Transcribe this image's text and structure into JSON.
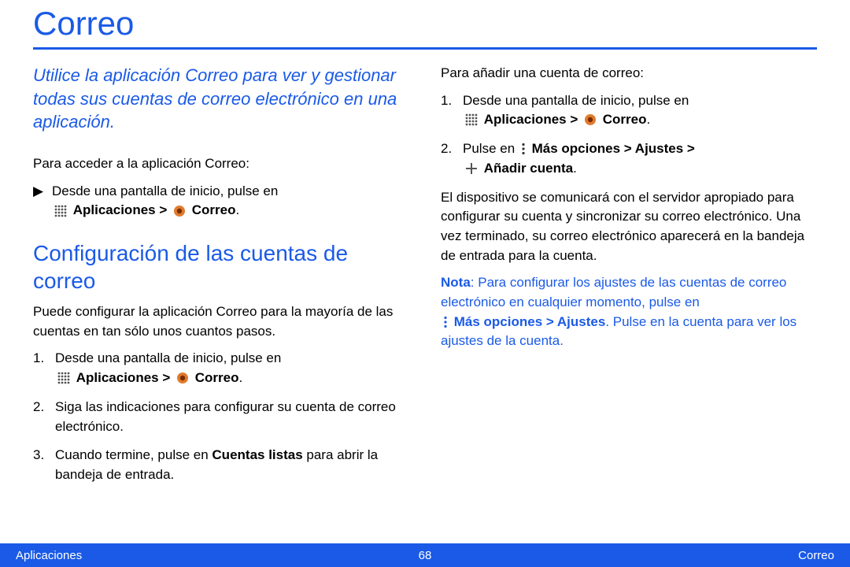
{
  "title": "Correo",
  "intro": "Utilice la aplicación Correo para ver y gestionar todas sus cuentas de correo electrónico en una aplicación.",
  "left": {
    "access_intro": "Para acceder a la aplicación Correo:",
    "access_step_pre": "Desde una pantalla de inicio, pulse en",
    "apps_label": "Aplicaciones >",
    "correo_label": "Correo",
    "period": ".",
    "section_heading": "Configuración de las cuentas de correo",
    "section_intro": "Puede configurar la aplicación Correo para la mayoría de las cuentas en tan sólo unos cuantos pasos.",
    "step1_pre": "Desde una pantalla de inicio, pulse en",
    "step2": "Siga las indicaciones para configurar su cuenta de correo electrónico.",
    "step3_pre": "Cuando termine, pulse en ",
    "step3_bold": "Cuentas listas",
    "step3_post": " para abrir la bandeja de entrada."
  },
  "right": {
    "add_intro": "Para añadir una cuenta de correo:",
    "step1_pre": "Desde una pantalla de inicio, pulse en",
    "apps_label": "Aplicaciones >",
    "correo_label": "Correo",
    "period": ".",
    "step2_pre": "Pulse en ",
    "more_options": "Más opciones > Ajustes >",
    "add_account": "Añadir cuenta",
    "result_para": "El dispositivo se comunicará con el servidor apropiado para configurar su cuenta y sincronizar su correo electrónico. Una vez terminado, su correo electrónico aparecerá en la bandeja de entrada para la cuenta.",
    "note_label": "Nota",
    "note_a": ": Para configurar los ajustes de las cuentas de correo electrónico en cualquier momento, pulse en",
    "note_more": "Más opciones > Ajustes",
    "note_b": ". Pulse en la cuenta para ver los ajustes de la cuenta."
  },
  "footer": {
    "left": "Aplicaciones",
    "center": "68",
    "right": "Correo"
  },
  "num": {
    "n1": "1.",
    "n2": "2.",
    "n3": "3."
  },
  "tri": "▶"
}
